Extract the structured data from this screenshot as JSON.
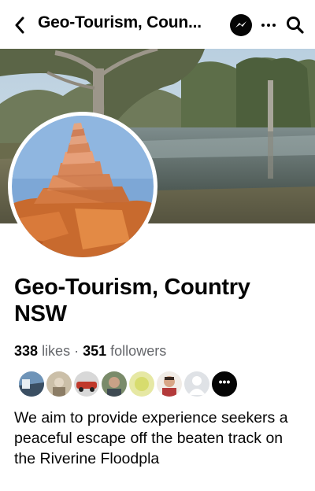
{
  "header": {
    "title": "Geo-Tourism, Coun...",
    "icons": [
      "chevron-left-icon",
      "messenger-icon",
      "more-icon",
      "search-icon"
    ]
  },
  "profile": {
    "name": "Geo-Tourism, Country NSW",
    "likes_count": "338",
    "likes_label": "likes",
    "separator": "·",
    "followers_count": "351",
    "followers_label": "followers",
    "more_fans_glyph": "•••",
    "bio": "We aim to provide experience seekers a peaceful escape off the beaten track on the Riverine Floodpla"
  },
  "colors": {
    "text": "#050505",
    "secondary_text": "#65676b",
    "background": "#ffffff"
  }
}
